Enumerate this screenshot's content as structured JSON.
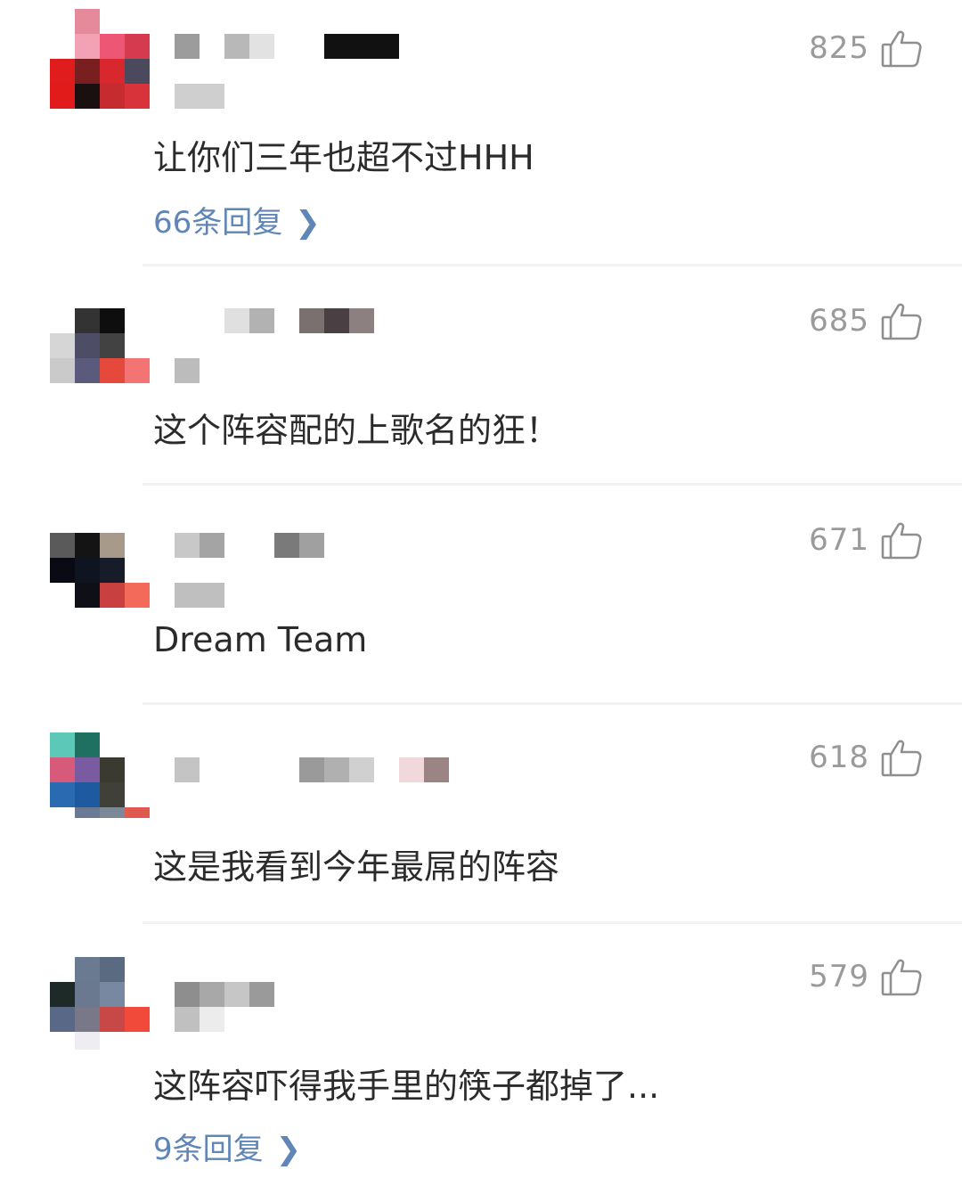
{
  "comments": [
    {
      "likes": "825",
      "text": "让你们三年也超不过HHH",
      "replies": "66条回复"
    },
    {
      "likes": "685",
      "text": "这个阵容配的上歌名的狂！",
      "replies": ""
    },
    {
      "likes": "671",
      "text": "Dream Team",
      "replies": ""
    },
    {
      "likes": "618",
      "text": "这是我看到今年最屌的阵容",
      "replies": ""
    },
    {
      "likes": "579",
      "text": "这阵容吓得我手里的筷子都掉了...",
      "replies": "9条回复"
    }
  ],
  "icons": {
    "like": "thumbs-up-icon",
    "reply_arrow": "chevron-right-icon"
  },
  "colors": {
    "reply_link": "#5f86b7",
    "like_count": "#9a9a9a",
    "comment_text": "#2b2b2b"
  }
}
